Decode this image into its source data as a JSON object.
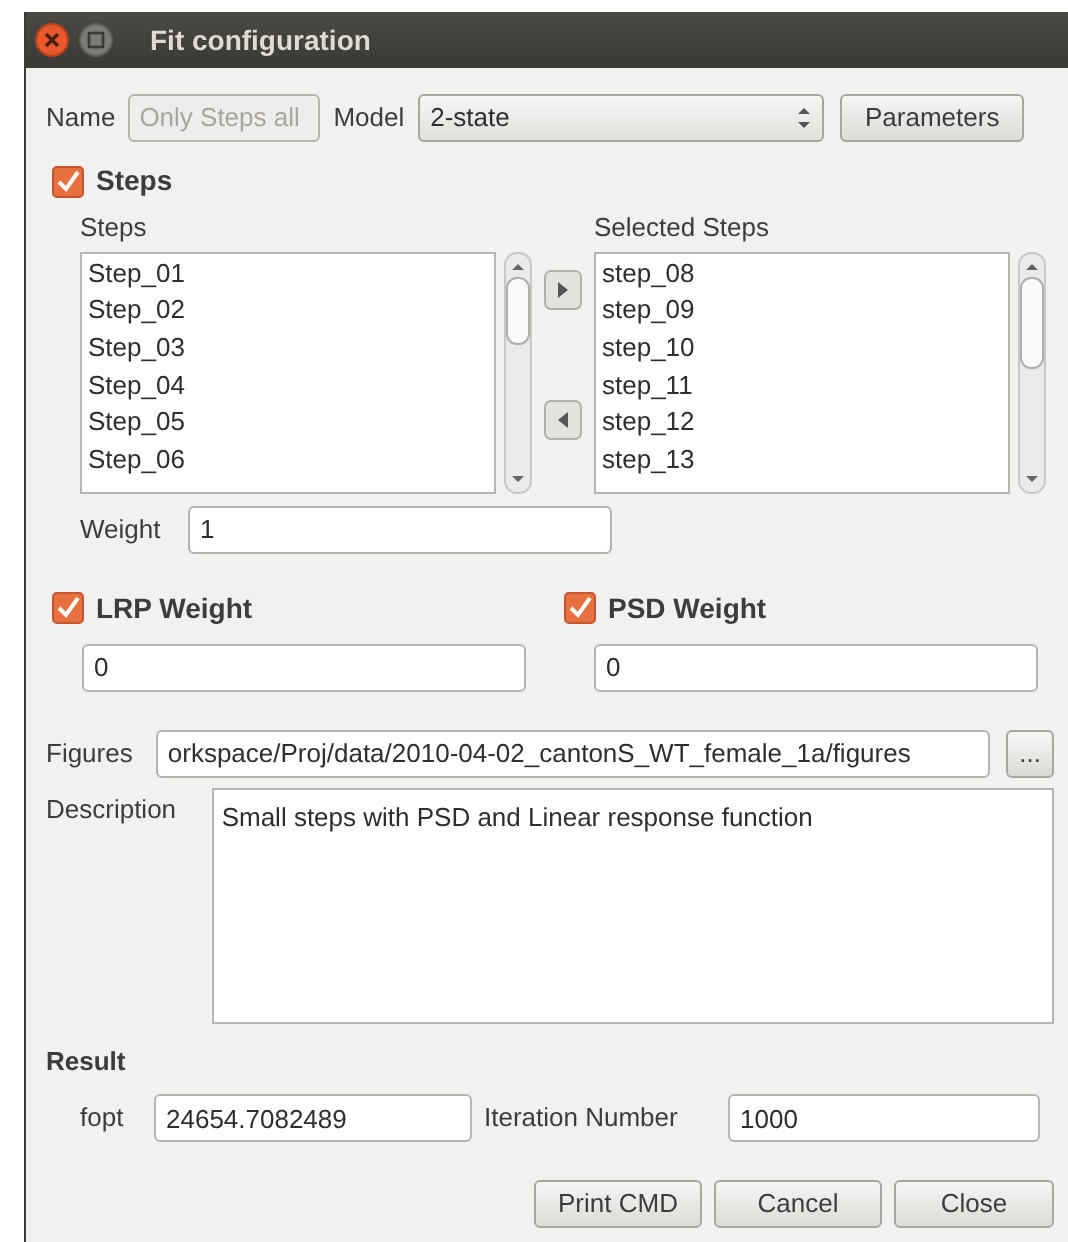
{
  "window": {
    "title": "Fit configuration"
  },
  "name": {
    "label": "Name",
    "value": "Only Steps all",
    "disabled": true
  },
  "model": {
    "label": "Model",
    "value": "2-state"
  },
  "parameters_button": "Parameters",
  "steps": {
    "label": "Steps",
    "checked": true,
    "available_label": "Steps",
    "selected_label": "Selected Steps",
    "available": [
      "Step_01",
      "Step_02",
      "Step_03",
      "Step_04",
      "Step_05",
      "Step_06"
    ],
    "selected": [
      "step_08",
      "step_09",
      "step_10",
      "step_11",
      "step_12",
      "step_13"
    ],
    "weight_label": "Weight",
    "weight": "1"
  },
  "lrp_weight": {
    "label": "LRP Weight",
    "checked": true,
    "value": "0"
  },
  "psd_weight": {
    "label": "PSD Weight",
    "checked": true,
    "value": "0"
  },
  "figures": {
    "label": "Figures",
    "value": "orkspace/Proj/data/2010-04-02_cantonS_WT_female_1a/figures",
    "browse": "..."
  },
  "description": {
    "label": "Description",
    "value": "Small steps with PSD and Linear response function"
  },
  "result": {
    "title": "Result",
    "fopt_label": "fopt",
    "fopt": "24654.7082489",
    "iter_label": "Iteration Number",
    "iter": "1000"
  },
  "buttons": [
    "Print CMD",
    "Cancel",
    "Close"
  ]
}
